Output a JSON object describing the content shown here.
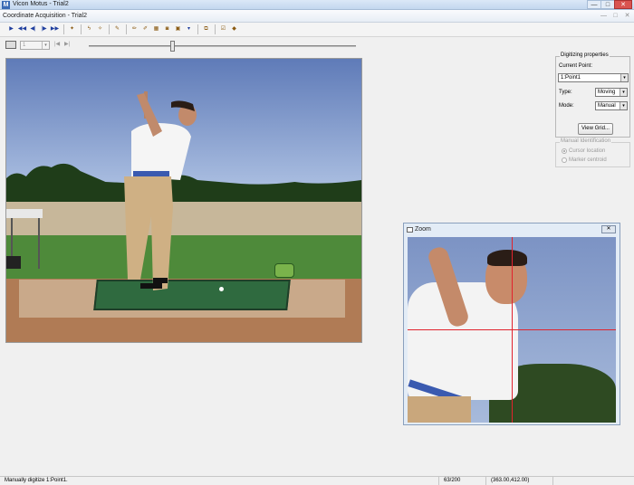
{
  "app": {
    "title": "Vicon Motus - Trial2",
    "icon_letter": "M"
  },
  "window_controls": {
    "minimize": "—",
    "maximize": "□",
    "close": "✕"
  },
  "child": {
    "title": "Coordinate Acquisition - Trial2"
  },
  "navigation": {
    "frame": "1"
  },
  "properties": {
    "legend": "Digitizing properties",
    "current_point_label": "Current Point:",
    "current_point_value": "1:Point1",
    "type_label": "Type:",
    "type_value": "Moving",
    "mode_label": "Mode:",
    "mode_value": "Manual",
    "view_grid_button": "View Grid..."
  },
  "manual_identification": {
    "legend": "Manual Identification",
    "option_cursor": "Cursor location",
    "option_marker": "Marker centroid"
  },
  "zoom": {
    "title": "Zoom",
    "close": "✕"
  },
  "status": {
    "message": "Manually digitize 1:Point1.",
    "frame_counter": "63/200",
    "coordinates": "(363.00,412.00)"
  },
  "colors": {
    "crosshair": "#e1232d",
    "accent": "#3a6bb5"
  }
}
